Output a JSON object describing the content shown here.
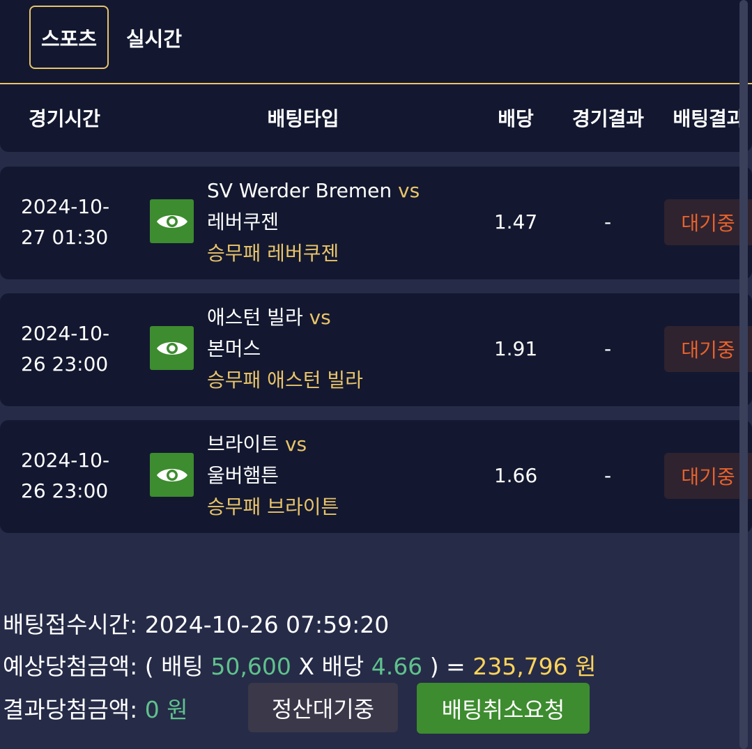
{
  "tabs": [
    {
      "label": "스포츠",
      "active": true
    },
    {
      "label": "실시간",
      "active": false
    }
  ],
  "table": {
    "headers": {
      "time": "경기시간",
      "type": "배팅타입",
      "odds": "배당",
      "result": "경기결과",
      "bet_result": "배팅결과"
    },
    "rows": [
      {
        "time_line1": "2024-10-",
        "time_line2": "27 01:30",
        "home": "SV Werder Bremen",
        "vs": "vs",
        "away": "레버쿠젠",
        "pick": "승무패 레버쿠젠",
        "odds": "1.47",
        "result": "-",
        "status": "대기중"
      },
      {
        "time_line1": "2024-10-",
        "time_line2": "26 23:00",
        "home": "애스턴 빌라",
        "vs": "vs",
        "away": "본머스",
        "pick": "승무패 애스턴 빌라",
        "odds": "1.91",
        "result": "-",
        "status": "대기중"
      },
      {
        "time_line1": "2024-10-",
        "time_line2": "26 23:00",
        "home": "브라이트",
        "vs": "vs",
        "away": "울버햄튼",
        "pick": "승무패 브라이튼",
        "odds": "1.66",
        "result": "-",
        "status": "대기중"
      }
    ]
  },
  "summary": {
    "bet_time_label": "배팅접수시간:",
    "bet_time_value": "2024-10-26 07:59:20",
    "expected_label": "예상당첨금액:",
    "open_paren": "(",
    "bet_word": "배팅",
    "bet_amount": "50,600",
    "times": "X",
    "odds_word": "배당",
    "total_odds": "4.66",
    "close_paren_eq": ") =",
    "expected_amount": "235,796 원",
    "result_label": "결과당첨금액:",
    "result_amount": "0 원"
  },
  "buttons": {
    "settle": "정산대기중",
    "cancel": "배팅취소요청"
  },
  "colors": {
    "background": "#262b48",
    "panel": "#131830",
    "accent_gold": "#e9c46a",
    "green_button": "#3d8c2f",
    "status_orange": "#e8622b",
    "amount_green": "#5fc28d"
  }
}
